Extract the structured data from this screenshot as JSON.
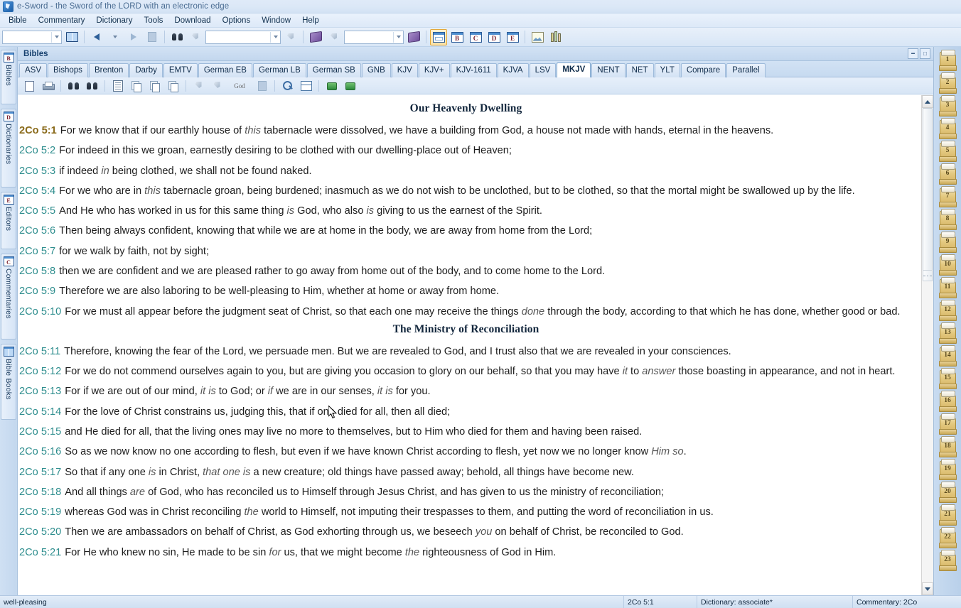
{
  "window": {
    "title": "e-Sword - the Sword of the LORD with an electronic edge",
    "app_icon": "sword-icon"
  },
  "menubar": {
    "items": [
      {
        "label": "Bible"
      },
      {
        "label": "Commentary"
      },
      {
        "label": "Dictionary"
      },
      {
        "label": "Tools"
      },
      {
        "label": "Download"
      },
      {
        "label": "Options"
      },
      {
        "label": "Window"
      },
      {
        "label": "Help"
      }
    ]
  },
  "toolbar": {
    "verse_combo_value": "",
    "search_combo_value": "",
    "dict_combo_value": "",
    "icons": [
      "open-book-icon",
      "back-arrow-icon",
      "history-dropdown-icon",
      "forward-arrow-icon",
      "stop-icon",
      "binoculars-search-icon",
      "search-go-icon",
      "search-submit-icon",
      "dictionary-icon",
      "dictionary-lookup-icon",
      "dictionary-go-icon"
    ],
    "window_layout": [
      {
        "label": "",
        "name": "layout-grid-button",
        "selected": true
      },
      {
        "label": "B",
        "name": "layout-bibles-button",
        "selected": false
      },
      {
        "label": "C",
        "name": "layout-commentaries-button",
        "selected": false
      },
      {
        "label": "D",
        "name": "layout-dictionaries-button",
        "selected": false
      },
      {
        "label": "E",
        "name": "layout-editors-button",
        "selected": false
      }
    ],
    "extra_icons": [
      "graphics-viewer-icon",
      "reference-library-icon"
    ]
  },
  "left_rail": {
    "tabs": [
      {
        "label": "Bibles",
        "letter": "B",
        "active": true
      },
      {
        "label": "Dictionaries",
        "letter": "D",
        "active": false
      },
      {
        "label": "Editors",
        "letter": "E",
        "active": false
      },
      {
        "label": "Commentaries",
        "letter": "C",
        "active": false
      },
      {
        "label": "Bible Books",
        "letter": "",
        "active": false
      }
    ]
  },
  "panel": {
    "title": "Bibles",
    "window_buttons": [
      "minimize-button",
      "maximize-button"
    ]
  },
  "bible_tabs": [
    {
      "label": "ASV",
      "active": false
    },
    {
      "label": "Bishops",
      "active": false
    },
    {
      "label": "Brenton",
      "active": false
    },
    {
      "label": "Darby",
      "active": false
    },
    {
      "label": "EMTV",
      "active": false
    },
    {
      "label": "German EB",
      "active": false
    },
    {
      "label": "German LB",
      "active": false
    },
    {
      "label": "German SB",
      "active": false
    },
    {
      "label": "GNB",
      "active": false
    },
    {
      "label": "KJV",
      "active": false
    },
    {
      "label": "KJV+",
      "active": false
    },
    {
      "label": "KJV-1611",
      "active": false
    },
    {
      "label": "KJVA",
      "active": false
    },
    {
      "label": "LSV",
      "active": false
    },
    {
      "label": "MKJV",
      "active": true
    },
    {
      "label": "NENT",
      "active": false
    },
    {
      "label": "NET",
      "active": false
    },
    {
      "label": "YLT",
      "active": false
    },
    {
      "label": "Compare",
      "active": false
    },
    {
      "label": "Parallel",
      "active": false
    }
  ],
  "doc_toolbar": {
    "icons": [
      "save-as-icon",
      "print-icon",
      "search-icon",
      "search-all-icon",
      "copy-verse-icon",
      "copy-icon",
      "copy-add-icon",
      "copy-special-icon",
      "highlight-icon",
      "highlight-clear-icon",
      "strongs-god-icon",
      "strongs-off-icon",
      "zoom-in-icon",
      "split-view-icon",
      "previous-chapter-icon",
      "next-chapter-icon"
    ],
    "strongs_label": "God"
  },
  "content": {
    "blocks": [
      {
        "type": "heading",
        "text": "Our Heavenly Dwelling"
      },
      {
        "type": "verse",
        "ref": "2Co 5:1",
        "current": true,
        "parts": [
          {
            "t": "For we know that if our earthly house of ",
            "i": false
          },
          {
            "t": "this",
            "i": true
          },
          {
            "t": " tabernacle were dissolved, we have a building from God, a house not made with hands, eternal in the heavens.",
            "i": false
          }
        ]
      },
      {
        "type": "verse",
        "ref": "2Co 5:2",
        "current": false,
        "parts": [
          {
            "t": "For indeed in this we groan, earnestly desiring to be clothed with our dwelling-place out of Heaven;",
            "i": false
          }
        ]
      },
      {
        "type": "verse",
        "ref": "2Co 5:3",
        "current": false,
        "parts": [
          {
            "t": "if indeed ",
            "i": false
          },
          {
            "t": "in",
            "i": true
          },
          {
            "t": " being clothed, we shall not be found naked.",
            "i": false
          }
        ]
      },
      {
        "type": "verse",
        "ref": "2Co 5:4",
        "current": false,
        "parts": [
          {
            "t": "For we who are in ",
            "i": false
          },
          {
            "t": "this",
            "i": true
          },
          {
            "t": " tabernacle groan, being burdened; inasmuch as we do not wish to be unclothed, but to be clothed, so that the mortal might be swallowed up by the life.",
            "i": false
          }
        ]
      },
      {
        "type": "verse",
        "ref": "2Co 5:5",
        "current": false,
        "parts": [
          {
            "t": "And He who has worked in us for this same thing ",
            "i": false
          },
          {
            "t": "is",
            "i": true
          },
          {
            "t": " God, who also ",
            "i": false
          },
          {
            "t": "is",
            "i": true
          },
          {
            "t": " giving to us the earnest of the Spirit.",
            "i": false
          }
        ]
      },
      {
        "type": "verse",
        "ref": "2Co 5:6",
        "current": false,
        "parts": [
          {
            "t": "Then being always confident, knowing that while we are at home in the body, we are away from home from the Lord;",
            "i": false
          }
        ]
      },
      {
        "type": "verse",
        "ref": "2Co 5:7",
        "current": false,
        "parts": [
          {
            "t": "for we walk by faith, not by sight;",
            "i": false
          }
        ]
      },
      {
        "type": "verse",
        "ref": "2Co 5:8",
        "current": false,
        "parts": [
          {
            "t": "then we are confident and we are pleased rather to go away from home out of the body, and to come home to the Lord.",
            "i": false
          }
        ]
      },
      {
        "type": "verse",
        "ref": "2Co 5:9",
        "current": false,
        "parts": [
          {
            "t": "Therefore we are also laboring to be well-pleasing to Him, whether at home or away from home.",
            "i": false
          }
        ]
      },
      {
        "type": "verse",
        "ref": "2Co 5:10",
        "current": false,
        "parts": [
          {
            "t": "For we must all appear before the judgment seat of Christ, so that each one may receive the things ",
            "i": false
          },
          {
            "t": "done",
            "i": true
          },
          {
            "t": " through the body, according to that which he has done, whether good or bad.",
            "i": false
          }
        ]
      },
      {
        "type": "heading",
        "text": "The Ministry of Reconciliation"
      },
      {
        "type": "verse",
        "ref": "2Co 5:11",
        "current": false,
        "parts": [
          {
            "t": "Therefore, knowing the fear of the Lord, we persuade men. But we are revealed to God, and I trust also that we are revealed in your consciences.",
            "i": false
          }
        ]
      },
      {
        "type": "verse",
        "ref": "2Co 5:12",
        "current": false,
        "parts": [
          {
            "t": "For we do not commend ourselves again to you, but are giving you occasion to glory on our behalf, so that you may have ",
            "i": false
          },
          {
            "t": "it",
            "i": true
          },
          {
            "t": " to ",
            "i": false
          },
          {
            "t": "answer",
            "i": true
          },
          {
            "t": " those boasting in appearance, and not in heart.",
            "i": false
          }
        ]
      },
      {
        "type": "verse",
        "ref": "2Co 5:13",
        "current": false,
        "parts": [
          {
            "t": "For if we are out of our mind, ",
            "i": false
          },
          {
            "t": "it is",
            "i": true
          },
          {
            "t": " to God; or ",
            "i": false
          },
          {
            "t": "if",
            "i": true
          },
          {
            "t": " we are in our senses, ",
            "i": false
          },
          {
            "t": "it is",
            "i": true
          },
          {
            "t": " for you.",
            "i": false
          }
        ]
      },
      {
        "type": "verse",
        "ref": "2Co 5:14",
        "current": false,
        "parts": [
          {
            "t": "For the love of Christ constrains us, judging this, that if one died for all, then all died;",
            "i": false
          }
        ]
      },
      {
        "type": "verse",
        "ref": "2Co 5:15",
        "current": false,
        "parts": [
          {
            "t": "and He died for all, that the living ones may live no more to themselves, but to Him who died for them and having been raised.",
            "i": false
          }
        ]
      },
      {
        "type": "verse",
        "ref": "2Co 5:16",
        "current": false,
        "parts": [
          {
            "t": "So as we now know no one according to flesh, but even if we have known Christ according to flesh, yet now we no longer know ",
            "i": false
          },
          {
            "t": "Him so",
            "i": true
          },
          {
            "t": ".",
            "i": false
          }
        ]
      },
      {
        "type": "verse",
        "ref": "2Co 5:17",
        "current": false,
        "parts": [
          {
            "t": "So that if any one ",
            "i": false
          },
          {
            "t": "is",
            "i": true
          },
          {
            "t": " in Christ, ",
            "i": false
          },
          {
            "t": "that one is",
            "i": true
          },
          {
            "t": " a new creature; old things have passed away; behold, all things have become new.",
            "i": false
          }
        ]
      },
      {
        "type": "verse",
        "ref": "2Co 5:18",
        "current": false,
        "parts": [
          {
            "t": "And all things ",
            "i": false
          },
          {
            "t": "are",
            "i": true
          },
          {
            "t": " of God, who has reconciled us to Himself through Jesus Christ, and has given to us the ministry of reconciliation;",
            "i": false
          }
        ]
      },
      {
        "type": "verse",
        "ref": "2Co 5:19",
        "current": false,
        "parts": [
          {
            "t": "whereas God was in Christ reconciling ",
            "i": false
          },
          {
            "t": "the",
            "i": true
          },
          {
            "t": " world to Himself, not imputing their trespasses to them, and putting the word of reconciliation in us.",
            "i": false
          }
        ]
      },
      {
        "type": "verse",
        "ref": "2Co 5:20",
        "current": false,
        "parts": [
          {
            "t": "Then we are ambassadors on behalf of Christ, as God exhorting through us, we beseech ",
            "i": false
          },
          {
            "t": "you",
            "i": true
          },
          {
            "t": " on behalf of Christ, be reconciled to God.",
            "i": false
          }
        ]
      },
      {
        "type": "verse",
        "ref": "2Co 5:21",
        "current": false,
        "clipped": true,
        "parts": [
          {
            "t": "For He who knew no sin, He made to be sin ",
            "i": false
          },
          {
            "t": "for",
            "i": true
          },
          {
            "t": " us, that we might become ",
            "i": false
          },
          {
            "t": "the",
            "i": true
          },
          {
            "t": " righteousness of God in Him.",
            "i": false
          }
        ]
      }
    ]
  },
  "right_rail": {
    "note_icons": [
      {
        "number": "1"
      },
      {
        "number": "2"
      },
      {
        "number": "3"
      },
      {
        "number": "4"
      },
      {
        "number": "5"
      },
      {
        "number": "6"
      },
      {
        "number": "7"
      },
      {
        "number": "8"
      },
      {
        "number": "9"
      },
      {
        "number": "10"
      },
      {
        "number": "11"
      },
      {
        "number": "12"
      },
      {
        "number": "13"
      },
      {
        "number": "14"
      },
      {
        "number": "15"
      },
      {
        "number": "16"
      },
      {
        "number": "17"
      },
      {
        "number": "18"
      },
      {
        "number": "19"
      },
      {
        "number": "20"
      },
      {
        "number": "21"
      },
      {
        "number": "22"
      },
      {
        "number": "23"
      }
    ]
  },
  "statusbar": {
    "selected_word": "well-pleasing",
    "reference": "2Co 5:1",
    "dictionary": "Dictionary: associate*",
    "commentary": "Commentary: 2Co"
  },
  "colors": {
    "verse_ref": "#2d8d8d",
    "current_verse_ref": "#8a6a1a",
    "heading": "#12263c",
    "title_text": "#4a6c92",
    "chrome": "#d6e4f5"
  }
}
